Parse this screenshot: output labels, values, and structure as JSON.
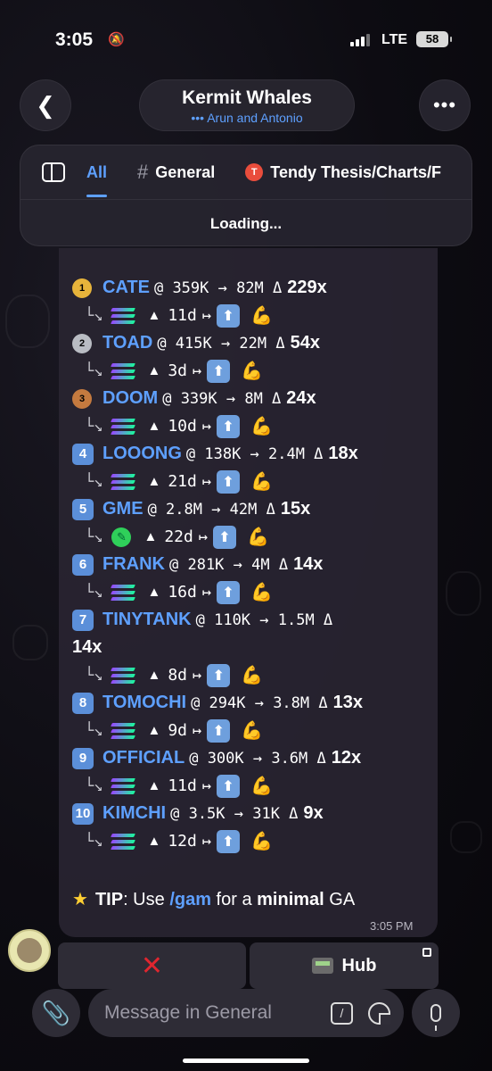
{
  "status": {
    "time": "3:05",
    "network": "LTE",
    "battery": "58"
  },
  "header": {
    "title": "Kermit Whales",
    "subtitle": "••• Arun and Antonio"
  },
  "tabs": [
    {
      "label": "All",
      "active": true
    },
    {
      "label": "General",
      "active": false
    },
    {
      "label": "Tendy Thesis/Charts/F",
      "active": false,
      "badge": "T"
    }
  ],
  "loading_text": "Loading...",
  "leaderboard": [
    {
      "rank": "1",
      "rank_type": "gold",
      "symbol": "CATE",
      "info": "@ 359K → 82M Δ",
      "mult": "229x",
      "days": "11d",
      "chain": "sol"
    },
    {
      "rank": "2",
      "rank_type": "silver",
      "symbol": "TOAD",
      "info": "@ 415K → 22M Δ",
      "mult": "54x",
      "days": "3d",
      "chain": "sol"
    },
    {
      "rank": "3",
      "rank_type": "bronze",
      "symbol": "DOOM",
      "info": "@ 339K → 8M Δ",
      "mult": "24x",
      "days": "10d",
      "chain": "sol"
    },
    {
      "rank": "4",
      "rank_type": "box",
      "symbol": "LOOONG",
      "info": "@ 138K → 2.4M Δ",
      "mult": "18x",
      "days": "21d",
      "chain": "sol"
    },
    {
      "rank": "5",
      "rank_type": "box",
      "symbol": "GME",
      "info": "@ 2.8M → 42M Δ",
      "mult": "15x",
      "days": "22d",
      "chain": "leaf"
    },
    {
      "rank": "6",
      "rank_type": "box",
      "symbol": "FRANK",
      "info": "@ 281K → 4M Δ",
      "mult": "14x",
      "days": "16d",
      "chain": "sol"
    },
    {
      "rank": "7",
      "rank_type": "box",
      "symbol": "TINYTANK",
      "info": "@ 110K → 1.5M Δ",
      "mult": "14x",
      "days": "8d",
      "chain": "sol",
      "wrap": true
    },
    {
      "rank": "8",
      "rank_type": "box",
      "symbol": "TOMOCHI",
      "info": "@ 294K → 3.8M Δ",
      "mult": "13x",
      "days": "9d",
      "chain": "sol"
    },
    {
      "rank": "9",
      "rank_type": "box",
      "symbol": "OFFICIAL",
      "info": "@ 300K → 3.6M Δ",
      "mult": "12x",
      "days": "11d",
      "chain": "sol"
    },
    {
      "rank": "10",
      "rank_type": "box",
      "symbol": "KIMCHI",
      "info": "@ 3.5K → 31K Δ",
      "mult": "9x",
      "days": "12d",
      "chain": "sol"
    }
  ],
  "row_glyphs": {
    "tree": "└↘",
    "triangle": "▲",
    "maps": "↦",
    "up": "⬆",
    "flex": "💪"
  },
  "tip": {
    "label": "TIP",
    "pre": ": Use ",
    "command": "/gam",
    "mid": " for a ",
    "bold": "minimal",
    "post": " GA"
  },
  "message_time": "3:05 PM",
  "keyboard": {
    "close_label": "✕",
    "hub_label": "Hub"
  },
  "composer": {
    "placeholder": "Message in General"
  },
  "colors": {
    "accent": "#5ea0ff",
    "close": "#e0262f"
  }
}
